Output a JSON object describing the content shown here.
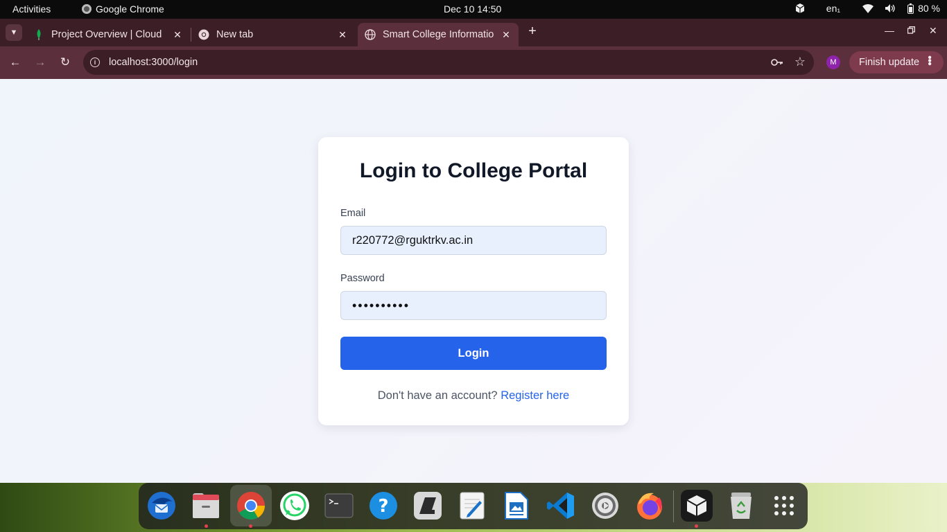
{
  "system": {
    "activities": "Activities",
    "app_name": "Google Chrome",
    "clock": "Dec 10  14:50",
    "lang": "en₁",
    "battery": "80 %"
  },
  "tabs": [
    {
      "title": "Project Overview | Cloud",
      "active": false
    },
    {
      "title": "New tab",
      "active": false
    },
    {
      "title": "Smart College Informatio",
      "active": true
    }
  ],
  "toolbar": {
    "url": "localhost:3000/login",
    "profile_initial": "M",
    "finish_update": "Finish update"
  },
  "login": {
    "title": "Login to College Portal",
    "email_label": "Email",
    "email_value": "r220772@rguktrkv.ac.in",
    "password_label": "Password",
    "password_value": "••••••••••",
    "button": "Login",
    "register_prompt": "Don't have an account?",
    "register_link": "Register here"
  },
  "colors": {
    "primary": "#2563eb",
    "tab_strip": "#3b1e26",
    "toolbar": "#5b2f3b"
  },
  "dock": [
    {
      "name": "thunderbird-icon"
    },
    {
      "name": "files-icon"
    },
    {
      "name": "chrome-icon"
    },
    {
      "name": "whatsapp-icon"
    },
    {
      "name": "terminal-icon"
    },
    {
      "name": "help-icon"
    },
    {
      "name": "screenshot-icon"
    },
    {
      "name": "text-editor-icon"
    },
    {
      "name": "writer-icon"
    },
    {
      "name": "vscode-icon"
    },
    {
      "name": "settings-icon"
    },
    {
      "name": "firefox-icon"
    },
    {
      "name": "virtualbox-icon"
    },
    {
      "name": "trash-icon"
    },
    {
      "name": "show-apps-icon"
    }
  ]
}
